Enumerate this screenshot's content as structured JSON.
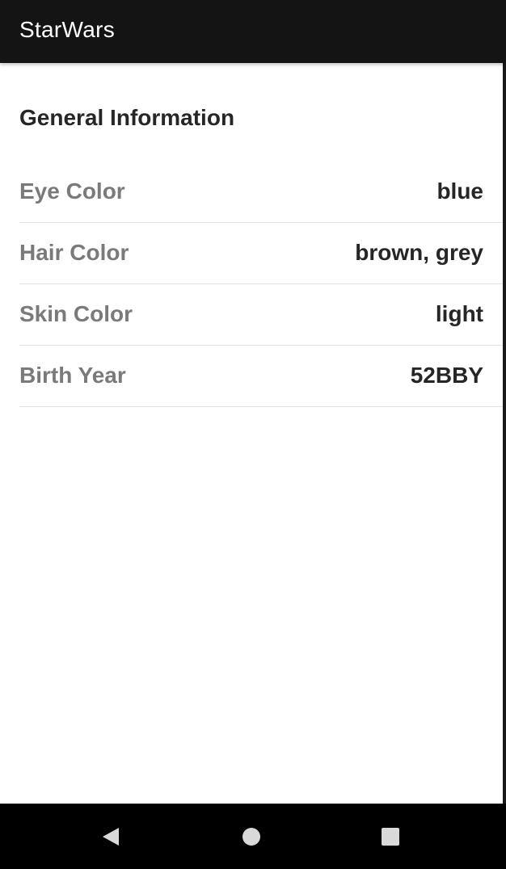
{
  "app_bar": {
    "title": "StarWars"
  },
  "section": {
    "title": "General Information"
  },
  "details": [
    {
      "label": "Eye Color",
      "value": "blue"
    },
    {
      "label": "Hair Color",
      "value": "brown, grey"
    },
    {
      "label": "Skin Color",
      "value": "light"
    },
    {
      "label": "Birth Year",
      "value": "52BBY"
    }
  ],
  "nav_bar": {
    "back_icon": "triangle-back-icon",
    "home_icon": "circle-home-icon",
    "recents_icon": "square-recents-icon"
  },
  "colors": {
    "app_bar_bg": "#141414",
    "nav_bar_bg": "#000000",
    "label": "#7a7a7a",
    "value": "#262626",
    "divider": "#e2e2e2",
    "nav_icon": "#d9d9d9"
  }
}
